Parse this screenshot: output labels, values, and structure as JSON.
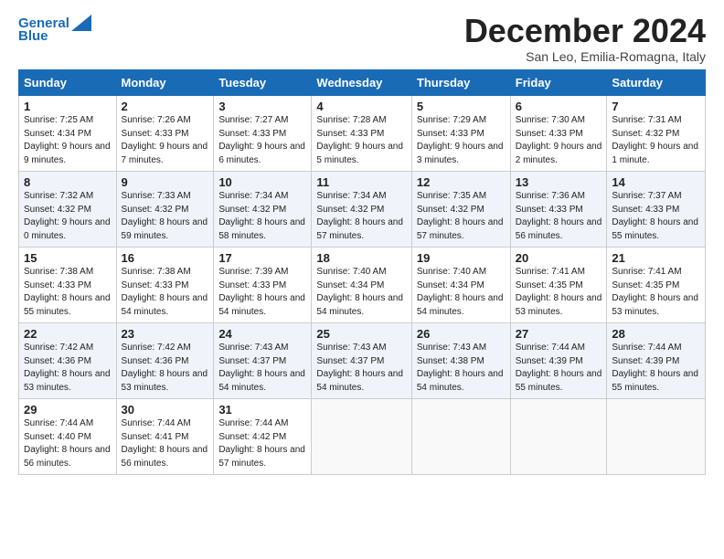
{
  "logo": {
    "line1": "General",
    "line2": "Blue"
  },
  "title": "December 2024",
  "subtitle": "San Leo, Emilia-Romagna, Italy",
  "days_of_week": [
    "Sunday",
    "Monday",
    "Tuesday",
    "Wednesday",
    "Thursday",
    "Friday",
    "Saturday"
  ],
  "weeks": [
    [
      {
        "day": "1",
        "sunrise": "7:25 AM",
        "sunset": "4:34 PM",
        "daylight": "9 hours and 9 minutes."
      },
      {
        "day": "2",
        "sunrise": "7:26 AM",
        "sunset": "4:33 PM",
        "daylight": "9 hours and 7 minutes."
      },
      {
        "day": "3",
        "sunrise": "7:27 AM",
        "sunset": "4:33 PM",
        "daylight": "9 hours and 6 minutes."
      },
      {
        "day": "4",
        "sunrise": "7:28 AM",
        "sunset": "4:33 PM",
        "daylight": "9 hours and 5 minutes."
      },
      {
        "day": "5",
        "sunrise": "7:29 AM",
        "sunset": "4:33 PM",
        "daylight": "9 hours and 3 minutes."
      },
      {
        "day": "6",
        "sunrise": "7:30 AM",
        "sunset": "4:33 PM",
        "daylight": "9 hours and 2 minutes."
      },
      {
        "day": "7",
        "sunrise": "7:31 AM",
        "sunset": "4:32 PM",
        "daylight": "9 hours and 1 minute."
      }
    ],
    [
      {
        "day": "8",
        "sunrise": "7:32 AM",
        "sunset": "4:32 PM",
        "daylight": "9 hours and 0 minutes."
      },
      {
        "day": "9",
        "sunrise": "7:33 AM",
        "sunset": "4:32 PM",
        "daylight": "8 hours and 59 minutes."
      },
      {
        "day": "10",
        "sunrise": "7:34 AM",
        "sunset": "4:32 PM",
        "daylight": "8 hours and 58 minutes."
      },
      {
        "day": "11",
        "sunrise": "7:34 AM",
        "sunset": "4:32 PM",
        "daylight": "8 hours and 57 minutes."
      },
      {
        "day": "12",
        "sunrise": "7:35 AM",
        "sunset": "4:32 PM",
        "daylight": "8 hours and 57 minutes."
      },
      {
        "day": "13",
        "sunrise": "7:36 AM",
        "sunset": "4:33 PM",
        "daylight": "8 hours and 56 minutes."
      },
      {
        "day": "14",
        "sunrise": "7:37 AM",
        "sunset": "4:33 PM",
        "daylight": "8 hours and 55 minutes."
      }
    ],
    [
      {
        "day": "15",
        "sunrise": "7:38 AM",
        "sunset": "4:33 PM",
        "daylight": "8 hours and 55 minutes."
      },
      {
        "day": "16",
        "sunrise": "7:38 AM",
        "sunset": "4:33 PM",
        "daylight": "8 hours and 54 minutes."
      },
      {
        "day": "17",
        "sunrise": "7:39 AM",
        "sunset": "4:33 PM",
        "daylight": "8 hours and 54 minutes."
      },
      {
        "day": "18",
        "sunrise": "7:40 AM",
        "sunset": "4:34 PM",
        "daylight": "8 hours and 54 minutes."
      },
      {
        "day": "19",
        "sunrise": "7:40 AM",
        "sunset": "4:34 PM",
        "daylight": "8 hours and 54 minutes."
      },
      {
        "day": "20",
        "sunrise": "7:41 AM",
        "sunset": "4:35 PM",
        "daylight": "8 hours and 53 minutes."
      },
      {
        "day": "21",
        "sunrise": "7:41 AM",
        "sunset": "4:35 PM",
        "daylight": "8 hours and 53 minutes."
      }
    ],
    [
      {
        "day": "22",
        "sunrise": "7:42 AM",
        "sunset": "4:36 PM",
        "daylight": "8 hours and 53 minutes."
      },
      {
        "day": "23",
        "sunrise": "7:42 AM",
        "sunset": "4:36 PM",
        "daylight": "8 hours and 53 minutes."
      },
      {
        "day": "24",
        "sunrise": "7:43 AM",
        "sunset": "4:37 PM",
        "daylight": "8 hours and 54 minutes."
      },
      {
        "day": "25",
        "sunrise": "7:43 AM",
        "sunset": "4:37 PM",
        "daylight": "8 hours and 54 minutes."
      },
      {
        "day": "26",
        "sunrise": "7:43 AM",
        "sunset": "4:38 PM",
        "daylight": "8 hours and 54 minutes."
      },
      {
        "day": "27",
        "sunrise": "7:44 AM",
        "sunset": "4:39 PM",
        "daylight": "8 hours and 55 minutes."
      },
      {
        "day": "28",
        "sunrise": "7:44 AM",
        "sunset": "4:39 PM",
        "daylight": "8 hours and 55 minutes."
      }
    ],
    [
      {
        "day": "29",
        "sunrise": "7:44 AM",
        "sunset": "4:40 PM",
        "daylight": "8 hours and 56 minutes."
      },
      {
        "day": "30",
        "sunrise": "7:44 AM",
        "sunset": "4:41 PM",
        "daylight": "8 hours and 56 minutes."
      },
      {
        "day": "31",
        "sunrise": "7:44 AM",
        "sunset": "4:42 PM",
        "daylight": "8 hours and 57 minutes."
      },
      null,
      null,
      null,
      null
    ]
  ]
}
